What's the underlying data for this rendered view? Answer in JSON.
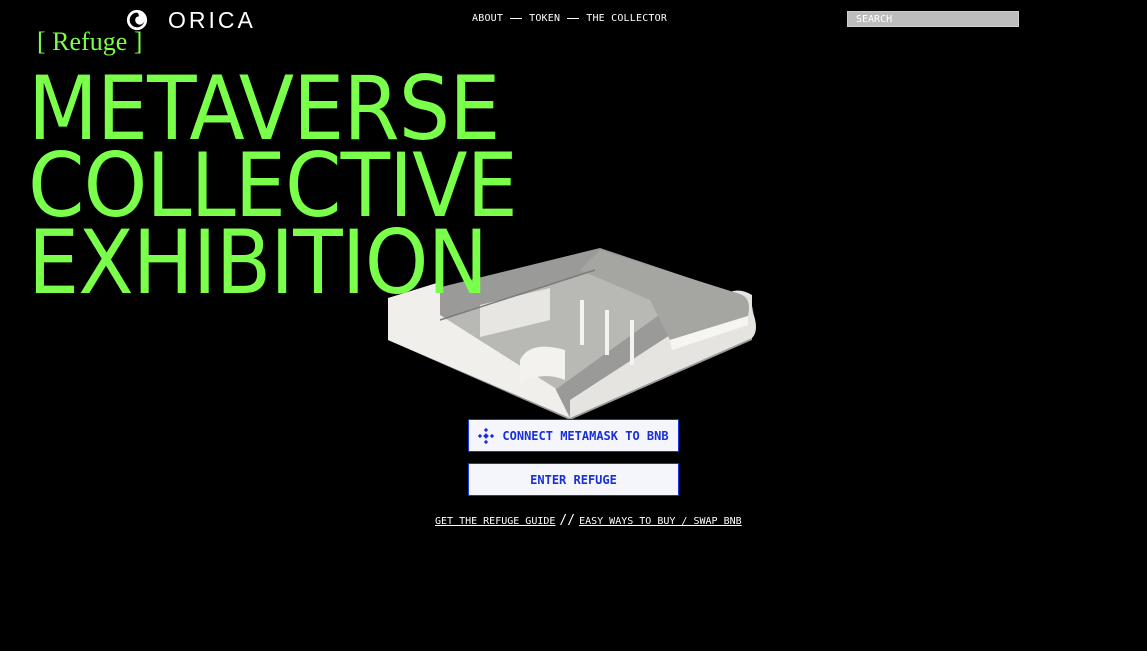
{
  "brand": {
    "name": "ORICA",
    "logo_icon": "orica-swirl-logo"
  },
  "nav": {
    "items": [
      {
        "label": "ABOUT"
      },
      {
        "label": "TOKEN"
      },
      {
        "label": "THE COLLECTOR"
      }
    ]
  },
  "search": {
    "placeholder": "SEARCH"
  },
  "hero": {
    "tag": "[ Refuge ]",
    "lines": [
      "METAVERSE",
      "COLLECTIVE",
      "EXHIBITION"
    ]
  },
  "actions": {
    "connect_label": "CONNECT METAMASK TO BNB",
    "connect_icon": "bnb-icon",
    "enter_label": "ENTER REFUGE"
  },
  "links": {
    "guide_label": "GET THE REFUGE GUIDE",
    "separator": "//",
    "buy_label": "EASY WAYS TO BUY / SWAP BNB"
  },
  "colors": {
    "background": "#000000",
    "accent_green": "#7aff4a",
    "button_blue": "#1a2fd8",
    "button_bg": "#f4f6fb"
  }
}
